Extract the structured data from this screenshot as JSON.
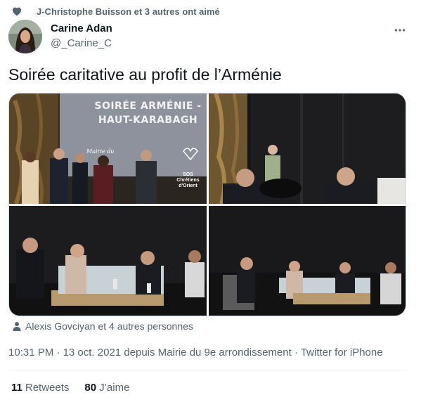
{
  "social_context": {
    "icon": "heart-icon",
    "text": "J-Christophe Buisson et 3 autres ont aimé"
  },
  "author": {
    "display_name": "Carine Adan",
    "handle": "@_Carine_C",
    "more_icon": "more-icon"
  },
  "tweet": {
    "text": "Soirée caritative au profit de l’Arménie"
  },
  "media": {
    "photo1": {
      "screen_text_line1": "SOIRÉE ARMÉNIE -",
      "screen_text_line2": "HAUT-KARABAGH",
      "sign_text": "Mairie du",
      "logo_text_1": "SOS",
      "logo_text_2": "Chrétiens d'Orient"
    }
  },
  "tagged": {
    "icon": "person-icon",
    "text": "Alexis Govciyan et 4 autres personnes"
  },
  "meta": {
    "time": "10:31 PM",
    "date": "13 oct. 2021",
    "location": "depuis Mairie du 9e arrondissement",
    "source": "Twitter for iPhone",
    "separator": " · "
  },
  "stats": {
    "retweets_count": "11",
    "retweets_label": "Retweets",
    "likes_count": "80",
    "likes_label": "J’aime"
  },
  "colors": {
    "text_primary": "#0f1419",
    "text_secondary": "#536471",
    "border": "#cfd9de"
  }
}
